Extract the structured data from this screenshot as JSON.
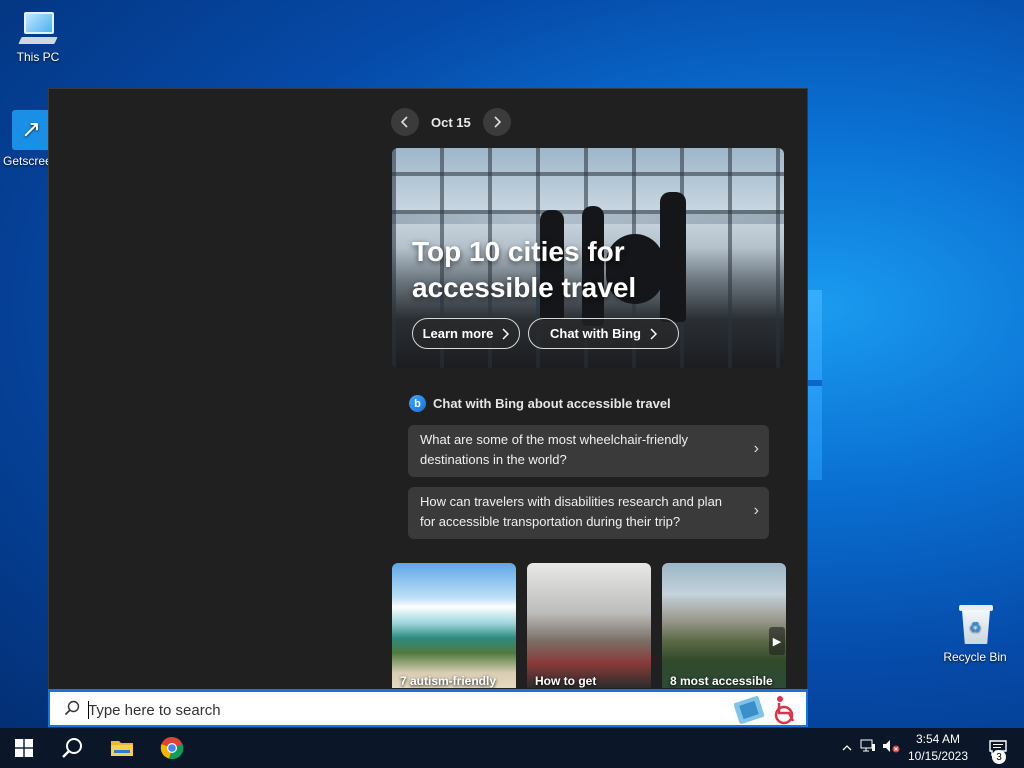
{
  "desktop": {
    "icons": [
      {
        "label": "This PC",
        "icon": "computer-icon"
      },
      {
        "label": "Getscree",
        "icon": "shortcut-arrow-icon"
      },
      {
        "label": "Recycle Bin",
        "icon": "recycle-bin-icon"
      }
    ]
  },
  "widget": {
    "date": "Oct 15",
    "hero": {
      "title": "Top 10 cities for accessible travel",
      "learn_more": "Learn more",
      "chat_bing": "Chat with Bing"
    },
    "bing": {
      "heading": "Chat with Bing about accessible travel",
      "questions": [
        "What are some of the most wheelchair-friendly destinations in the world?",
        "How can travelers with disabilities research and plan for accessible transportation during their trip?"
      ]
    },
    "cards": [
      {
        "caption": "7 autism-friendly"
      },
      {
        "caption": "How to get"
      },
      {
        "caption": "8 most accessible"
      }
    ]
  },
  "search": {
    "placeholder": "Type here to search"
  },
  "taskbar": {
    "apps": [
      "start-icon",
      "search-icon",
      "file-explorer-icon",
      "chrome-icon"
    ],
    "clock_time": "3:54 AM",
    "clock_date": "10/15/2023",
    "notification_count": "3"
  },
  "colors": {
    "panel_bg": "#202020",
    "card_bg": "#3a3a3a",
    "accent": "#1a73d9",
    "taskbar_bg": "#0b1628"
  }
}
